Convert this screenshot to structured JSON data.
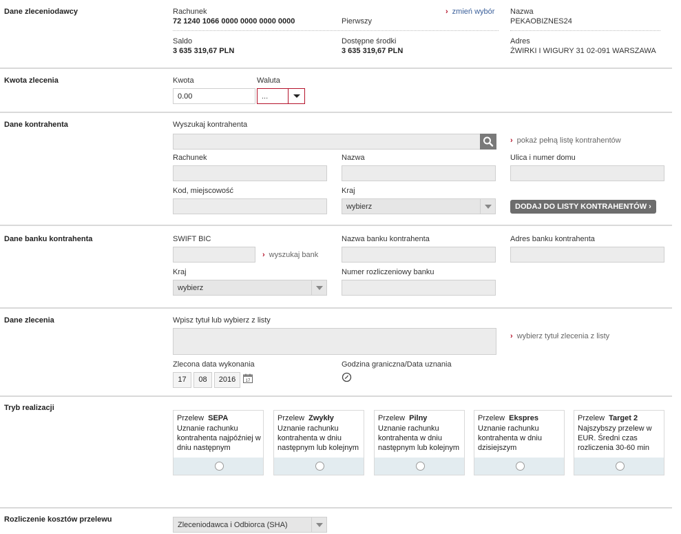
{
  "sections": {
    "principal": "Dane zleceniodawcy",
    "amount": "Kwota zlecenia",
    "contractor": "Dane kontrahenta",
    "bank": "Dane banku kontrahenta",
    "order": "Dane zlecenia",
    "mode": "Tryb realizacji",
    "costs": "Rozliczenie kosztów przelewu"
  },
  "principal": {
    "account_label": "Rachunek",
    "account_number": "72 1240 1066 0000 0000 0000 0000",
    "account_name": "Pierwszy",
    "change_link": "zmień wybór",
    "balance_label": "Saldo",
    "balance_value": "3 635 319,67 PLN",
    "available_label": "Dostępne środki",
    "available_value": "3 635 319,67 PLN",
    "name_label": "Nazwa",
    "name_value": "PEKAOBIZNES24",
    "address_label": "Adres",
    "address_value": "ŻWIRKI I WIGURY 31 02-091 WARSZAWA"
  },
  "amount": {
    "amount_label": "Kwota",
    "amount_value": "0.00",
    "currency_label": "Waluta",
    "currency_value": "..."
  },
  "contractor": {
    "search_label": "Wyszukaj kontrahenta",
    "search_value": "",
    "full_list_link": "pokaż pełną listę kontrahentów",
    "account_label": "Rachunek",
    "name_label": "Nazwa",
    "street_label": "Ulica i numer domu",
    "postal_label": "Kod, miejscowość",
    "country_label": "Kraj",
    "country_value": "wybierz",
    "add_button": "DODAJ DO LISTY KONTRAHENTÓW"
  },
  "bank": {
    "swift_label": "SWIFT BIC",
    "search_bank_link": "wyszukaj bank",
    "bank_name_label": "Nazwa banku kontrahenta",
    "bank_address_label": "Adres banku kontrahenta",
    "country_label": "Kraj",
    "country_value": "wybierz",
    "settlement_label": "Numer rozliczeniowy banku"
  },
  "order": {
    "title_label": "Wpisz tytuł lub wybierz z listy",
    "choose_title_link": "wybierz tytuł zlecenia z listy",
    "date_label": "Zlecona data wykonania",
    "day": "17",
    "month": "08",
    "year": "2016",
    "deadline_label": "Godzina graniczna/Data uznania"
  },
  "modes": [
    {
      "prefix": "Przelew",
      "name": "SEPA",
      "desc": "Uznanie rachunku kontrahenta najpóźniej w dniu następnym"
    },
    {
      "prefix": "Przelew",
      "name": "Zwykły",
      "desc": "Uznanie rachunku kontrahenta w dniu następnym lub kolejnym"
    },
    {
      "prefix": "Przelew",
      "name": "Pilny",
      "desc": "Uznanie rachunku kontrahenta w dniu następnym lub kolejnym"
    },
    {
      "prefix": "Przelew",
      "name": "Ekspres",
      "desc": "Uznanie rachunku kontrahenta w dniu dzisiejszym"
    },
    {
      "prefix": "Przelew",
      "name": "Target 2",
      "desc": "Najszybszy przelew w EUR. Średni czas rozliczenia 30-60 min"
    }
  ],
  "costs": {
    "value": "Zleceniodawca i Odbiorca (SHA)"
  },
  "colors": {
    "accent": "#b4122a",
    "link_blue": "#3a5f9a",
    "card_footer": "#e3ecf0"
  }
}
